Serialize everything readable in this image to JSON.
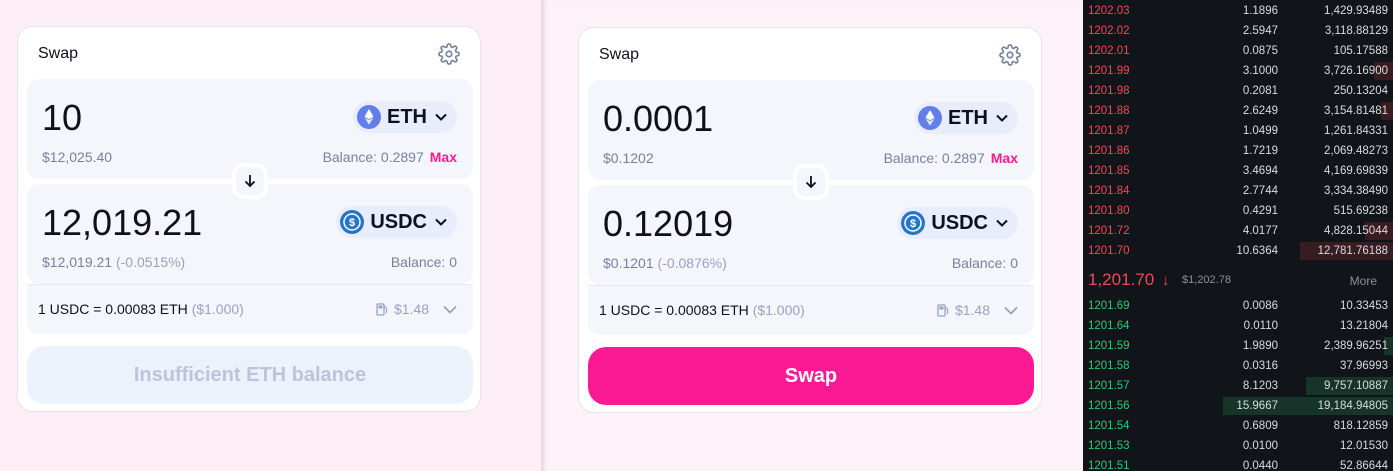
{
  "left_swap": {
    "title": "Swap",
    "from": {
      "amount": "10",
      "usd": "$12,025.40",
      "token": "ETH",
      "balance": "Balance: 0.2897",
      "max": "Max"
    },
    "to": {
      "amount": "12,019.21",
      "usd": "$12,019.21",
      "pct": "(-0.0515%)",
      "token": "USDC",
      "balance": "Balance: 0"
    },
    "rate": "1 USDC = 0.00083 ETH",
    "rate_usd": "($1.000)",
    "gas": "$1.48",
    "action_label": "Insufficient ETH balance"
  },
  "right_swap": {
    "title": "Swap",
    "from": {
      "amount": "0.0001",
      "usd": "$0.1202",
      "token": "ETH",
      "balance": "Balance: 0.2897",
      "max": "Max"
    },
    "to": {
      "amount": "0.12019",
      "usd": "$0.1201",
      "pct": "(-0.0876%)",
      "token": "USDC",
      "balance": "Balance: 0"
    },
    "rate": "1 USDC = 0.00083 ETH",
    "rate_usd": "($1.000)",
    "gas": "$1.48",
    "action_label": "Swap"
  },
  "colors": {
    "accent": "#fc1a94",
    "ask": "#f04a5a",
    "bid": "#2ec97a",
    "eth": "#627eea",
    "usdc": "#2775ca"
  },
  "icons": [
    "gear-icon",
    "eth-icon",
    "usdc-icon",
    "chevron-down-icon",
    "arrow-down-icon",
    "gas-pump-icon"
  ],
  "orderbook": {
    "asks": [
      {
        "price": "1202.03",
        "qty": "1.1896",
        "total": "1,429.93489",
        "depth": 0
      },
      {
        "price": "1202.02",
        "qty": "2.5947",
        "total": "3,118.88129",
        "depth": 0
      },
      {
        "price": "1202.01",
        "qty": "0.0875",
        "total": "105.17588",
        "depth": 0
      },
      {
        "price": "1201.99",
        "qty": "3.1000",
        "total": "3,726.16900",
        "depth": 0.06
      },
      {
        "price": "1201.98",
        "qty": "0.2081",
        "total": "250.13204",
        "depth": 0
      },
      {
        "price": "1201.88",
        "qty": "2.6249",
        "total": "3,154.81481",
        "depth": 0.04
      },
      {
        "price": "1201.87",
        "qty": "1.0499",
        "total": "1,261.84331",
        "depth": 0
      },
      {
        "price": "1201.86",
        "qty": "1.7219",
        "total": "2,069.48273",
        "depth": 0
      },
      {
        "price": "1201.85",
        "qty": "3.4694",
        "total": "4,169.69839",
        "depth": 0
      },
      {
        "price": "1201.84",
        "qty": "2.7744",
        "total": "3,334.38490",
        "depth": 0
      },
      {
        "price": "1201.80",
        "qty": "0.4291",
        "total": "515.69238",
        "depth": 0
      },
      {
        "price": "1201.72",
        "qty": "4.0177",
        "total": "4,828.15044",
        "depth": 0.09
      },
      {
        "price": "1201.70",
        "qty": "10.6364",
        "total": "12,781.76188",
        "depth": 0.3
      }
    ],
    "last_price": "1,201.70",
    "last_arrow": "↓",
    "mark_price": "$1,202.78",
    "more_label": "More",
    "bids": [
      {
        "price": "1201.69",
        "qty": "0.0086",
        "total": "10.33453",
        "depth": 0
      },
      {
        "price": "1201.64",
        "qty": "0.0110",
        "total": "13.21804",
        "depth": 0
      },
      {
        "price": "1201.59",
        "qty": "1.9890",
        "total": "2,389.96251",
        "depth": 0.03
      },
      {
        "price": "1201.58",
        "qty": "0.0316",
        "total": "37.96993",
        "depth": 0
      },
      {
        "price": "1201.57",
        "qty": "8.1203",
        "total": "9,757.10887",
        "depth": 0.28
      },
      {
        "price": "1201.56",
        "qty": "15.9667",
        "total": "19,184.94805",
        "depth": 0.55
      },
      {
        "price": "1201.54",
        "qty": "0.6809",
        "total": "818.12859",
        "depth": 0
      },
      {
        "price": "1201.53",
        "qty": "0.0100",
        "total": "12.01530",
        "depth": 0
      },
      {
        "price": "1201.51",
        "qty": "0.0440",
        "total": "52.86644",
        "depth": 0
      }
    ]
  }
}
